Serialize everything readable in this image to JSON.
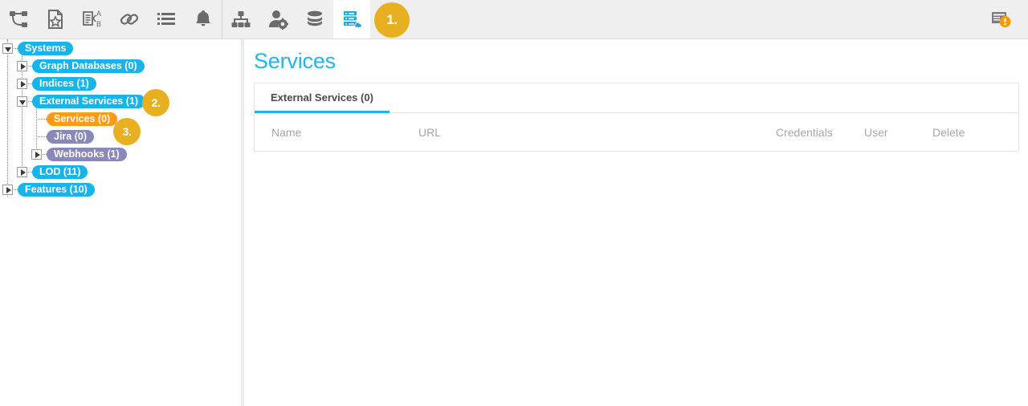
{
  "toolbar": {
    "groups": [
      {
        "buttons": [
          {
            "name": "network-nodes-icon",
            "label": "Network"
          },
          {
            "name": "document-star-icon",
            "label": "Favorite Document"
          },
          {
            "name": "document-translate-icon",
            "label": "Translate Document"
          },
          {
            "name": "link-chain-icon",
            "label": "Links"
          },
          {
            "name": "list-icon",
            "label": "List"
          },
          {
            "name": "bell-icon",
            "label": "Notifications"
          }
        ]
      },
      {
        "buttons": [
          {
            "name": "org-hierarchy-icon",
            "label": "Hierarchy"
          },
          {
            "name": "user-settings-icon",
            "label": "User Administration"
          },
          {
            "name": "database-icon",
            "label": "Databases"
          },
          {
            "name": "server-cloud-icon",
            "label": "Systems",
            "active": true
          }
        ]
      }
    ],
    "status": {
      "name": "log-warning-icon",
      "label": "System Log Warning"
    }
  },
  "annotations": [
    {
      "id": "badge1",
      "text": "1."
    },
    {
      "id": "badge2",
      "text": "2."
    },
    {
      "id": "badge3",
      "text": "3."
    }
  ],
  "sidebar": {
    "tree": [
      {
        "label": "Systems",
        "color": "blue",
        "toggle": "expanded",
        "depth": 0
      },
      {
        "label": "Graph Databases (0)",
        "color": "blue",
        "toggle": "collapsed",
        "depth": 1
      },
      {
        "label": "Indices (1)",
        "color": "blue",
        "toggle": "collapsed",
        "depth": 1
      },
      {
        "label": "External Services (1)",
        "color": "blue",
        "toggle": "expanded",
        "depth": 1
      },
      {
        "label": "Services (0)",
        "color": "orange",
        "toggle": "none",
        "depth": 2
      },
      {
        "label": "Jira (0)",
        "color": "purple",
        "toggle": "none",
        "depth": 2
      },
      {
        "label": "Webhooks (1)",
        "color": "purple",
        "toggle": "collapsed",
        "depth": 2
      },
      {
        "label": "LOD (11)",
        "color": "blue",
        "toggle": "collapsed",
        "depth": 1
      },
      {
        "label": "Features (10)",
        "color": "blue",
        "toggle": "collapsed",
        "depth": 0
      }
    ]
  },
  "main": {
    "title": "Services",
    "tabs": [
      {
        "label": "External Services (0)",
        "active": true
      }
    ],
    "table": {
      "columns": [
        "Name",
        "URL",
        "Credentials",
        "User",
        "Delete"
      ],
      "rows": []
    }
  },
  "colors": {
    "accent": "#21b5ef",
    "node_blue": "#17b4ec",
    "node_orange": "#ff9b15",
    "node_purple": "#8888bb",
    "badge": "#e8af20",
    "toolbar_bg": "#efefef"
  }
}
